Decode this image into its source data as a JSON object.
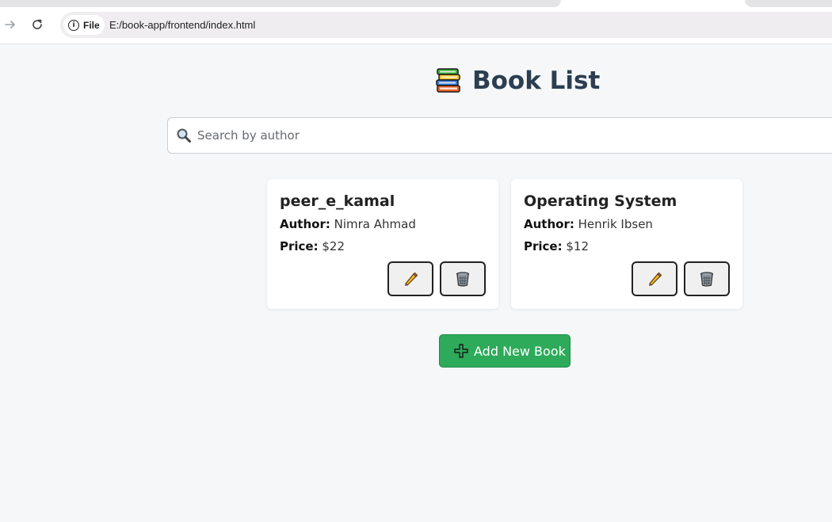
{
  "browser": {
    "file_label": "File",
    "url": "E:/book-app/frontend/index.html"
  },
  "header": {
    "title": "Book List",
    "icon": "books-icon"
  },
  "search": {
    "placeholder": "Search by author",
    "value": ""
  },
  "books": [
    {
      "title": "peer_e_kamal",
      "author_label": "Author:",
      "author": "Nimra Ahmad",
      "price_label": "Price:",
      "price": "$22"
    },
    {
      "title": "Operating System",
      "author_label": "Author:",
      "author": "Henrik Ibsen",
      "price_label": "Price:",
      "price": "$12"
    }
  ],
  "actions": {
    "add_label": "Add New Book",
    "edit_icon": "pencil-icon",
    "delete_icon": "trash-icon"
  },
  "colors": {
    "background": "#f5f7f9",
    "title": "#2c3e50",
    "add_button": "#2daa5a"
  }
}
